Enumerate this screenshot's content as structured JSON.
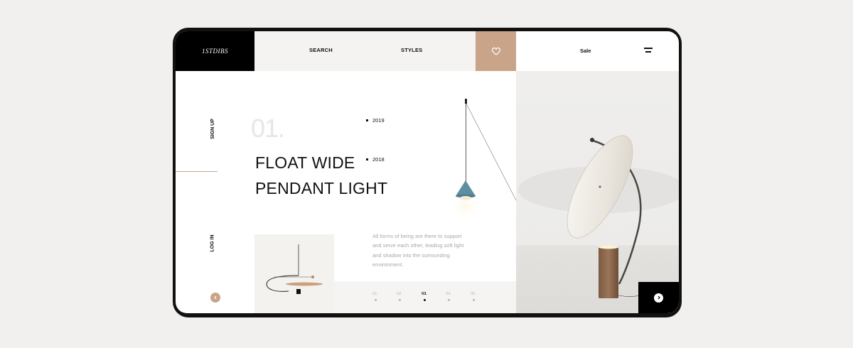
{
  "header": {
    "logo": "1STDIBS",
    "nav": [
      "SEARCH",
      "STYLES"
    ],
    "sale_label": "Sale",
    "favorite_icon": "heart-icon",
    "menu_icon": "menu-icon"
  },
  "sidebar": {
    "sign_up": "SIGN UP",
    "log_in": "LOG IN",
    "prev_icon": "chevron-left-icon"
  },
  "hero": {
    "number": "01.",
    "title_line1": "FLOAT WIDE",
    "title_line2": "PENDANT LIGHT",
    "years": [
      "2019",
      "2018"
    ],
    "description_lines": [
      "All forms of being are there to support",
      "and serve each other, leading soft light",
      "and shadow into the surrounding",
      "environment."
    ]
  },
  "pager": {
    "items": [
      "01.",
      "02.",
      "03.",
      "04.",
      "05."
    ],
    "active_index": 2
  },
  "photo": {
    "next_icon": "chevron-right-icon"
  },
  "colors": {
    "accent": "#c9a489",
    "dark": "#000000",
    "nav_bg": "#f4f3f1",
    "text_muted": "#a8a8a8"
  }
}
